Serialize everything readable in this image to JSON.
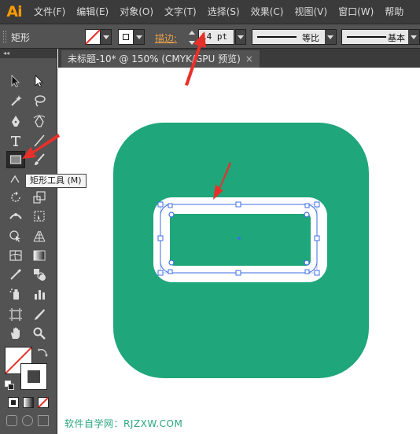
{
  "app": {
    "logo": "Ai"
  },
  "menu": [
    "文件(F)",
    "编辑(E)",
    "对象(O)",
    "文字(T)",
    "选择(S)",
    "效果(C)",
    "视图(V)",
    "窗口(W)",
    "帮助"
  ],
  "control_bar": {
    "tool_name": "矩形",
    "stroke_label": "描边",
    "stroke_colon": ":",
    "stroke_value": "14 pt",
    "profile_label": "等比",
    "brush_label": "基本"
  },
  "document": {
    "tab_title": "未标题-10* @ 150% (CMYK/GPU 预览)",
    "tab_close": "×"
  },
  "tools": {
    "panel_collapse": "◂◂",
    "tooltip": "矩形工具 (M)",
    "selected": "rectangle-tool"
  },
  "artwork": {
    "background_color": "#1fa67b",
    "inner_color": "#1fa67b",
    "frame_color": "#ffffff",
    "selection_color": "#3c6ee6"
  },
  "colors": {
    "annotation_arrow": "#e8302a",
    "stroke_label": "#e8a04a",
    "watermark": "#2aa77a"
  },
  "watermark": "软件自学网：RJZXW.COM"
}
